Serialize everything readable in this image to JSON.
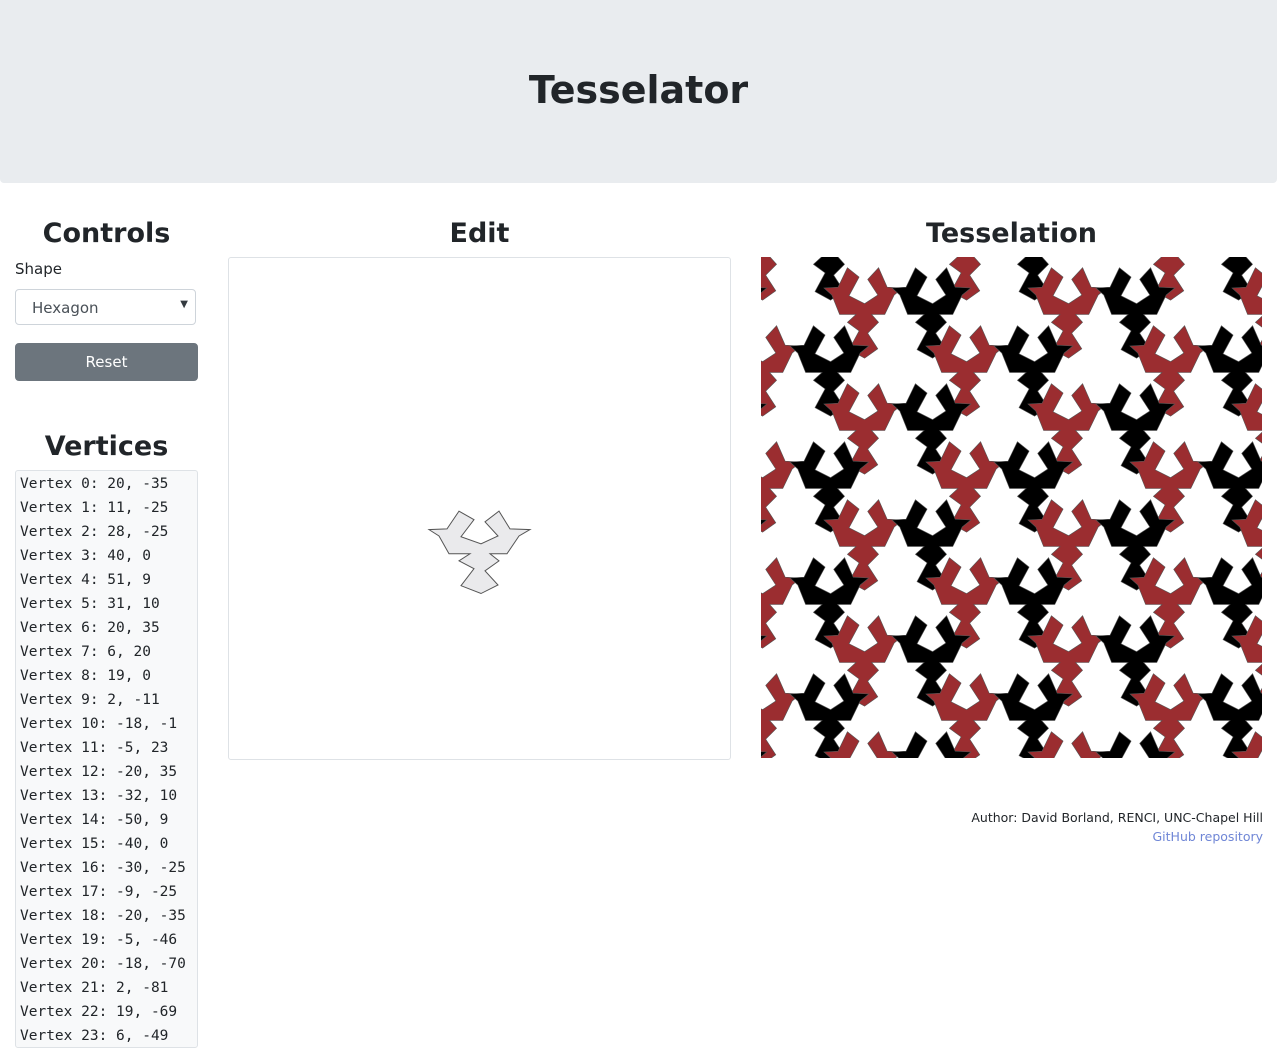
{
  "header": {
    "title": "Tesselator"
  },
  "controls": {
    "title": "Controls",
    "shape_label": "Shape",
    "shape_value": "Hexagon",
    "reset_label": "Reset"
  },
  "vertices": {
    "title": "Vertices",
    "items": [
      "Vertex 0: 20, -35",
      "Vertex 1: 11, -25",
      "Vertex 2: 28, -25",
      "Vertex 3: 40, 0",
      "Vertex 4: 51, 9",
      "Vertex 5: 31, 10",
      "Vertex 6: 20, 35",
      "Vertex 7: 6, 20",
      "Vertex 8: 19, 0",
      "Vertex 9: 2, -11",
      "Vertex 10: -18, -1",
      "Vertex 11: -5, 23",
      "Vertex 12: -20, 35",
      "Vertex 13: -32, 10",
      "Vertex 14: -50, 9",
      "Vertex 15: -40, 0",
      "Vertex 16: -30, -25",
      "Vertex 17: -9, -25",
      "Vertex 18: -20, -35",
      "Vertex 19: -5, -46",
      "Vertex 20: -18, -70",
      "Vertex 21: 2, -81",
      "Vertex 22: 19, -69",
      "Vertex 23: 6, -49"
    ]
  },
  "edit": {
    "title": "Edit"
  },
  "tesselation": {
    "title": "Tesselation",
    "colors": [
      "#9b2d30",
      "#000000",
      "#ffffff"
    ],
    "outline": "#555555",
    "shape_fill": "#eaeaec"
  },
  "footer": {
    "author": "Author: David Borland, RENCI, UNC-Chapel Hill",
    "link": "GitHub repository"
  }
}
